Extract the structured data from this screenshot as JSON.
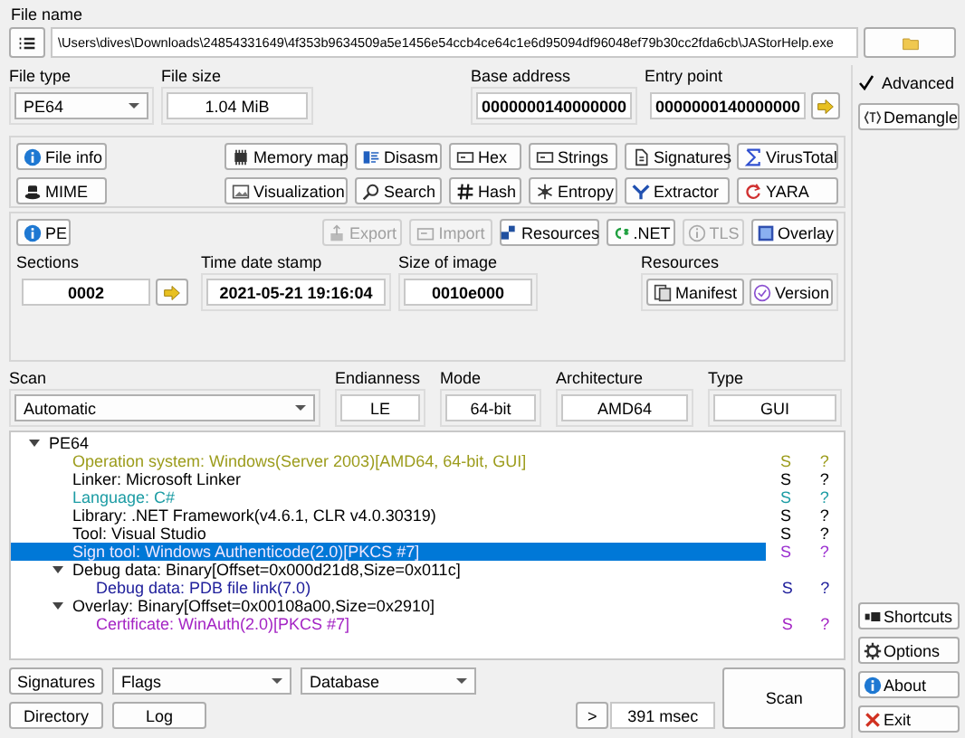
{
  "file_name": {
    "label": "File name",
    "path": "\\Users\\dives\\Downloads\\24854331649\\4f353b9634509a5e1456e54ccb4ce64c1e6d95094df96048ef79b30cc2fda6cb\\JAStorHelp.exe"
  },
  "file_type": {
    "label": "File type",
    "value": "PE64"
  },
  "file_size": {
    "label": "File size",
    "value": "1.04 MiB"
  },
  "base_address": {
    "label": "Base address",
    "value": "0000000140000000"
  },
  "entry_point": {
    "label": "Entry point",
    "value": "0000000140000000"
  },
  "tools_row_1": [
    "File info",
    "Memory map",
    "Disasm",
    "Hex",
    "Strings",
    "Signatures",
    "VirusTotal"
  ],
  "tools_row_2": [
    "MIME",
    "Visualization",
    "Search",
    "Hash",
    "Entropy",
    "Extractor",
    "YARA"
  ],
  "pe_panel": {
    "title": "PE",
    "buttons": [
      {
        "label": "Export",
        "disabled": true
      },
      {
        "label": "Import",
        "disabled": true
      },
      {
        "label": "Resources",
        "disabled": false
      },
      {
        "label": ".NET",
        "disabled": false
      },
      {
        "label": "TLS",
        "disabled": true
      },
      {
        "label": "Overlay",
        "disabled": false
      }
    ],
    "sections": {
      "label": "Sections",
      "value": "0002"
    },
    "time_date_stamp": {
      "label": "Time date stamp",
      "value": "2021-05-21 19:16:04"
    },
    "size_of_image": {
      "label": "Size of image",
      "value": "0010e000"
    },
    "resources": {
      "label": "Resources",
      "buttons": [
        "Manifest",
        "Version"
      ]
    }
  },
  "scan": {
    "label": "Scan",
    "value": "Automatic"
  },
  "endianness": {
    "label": "Endianness",
    "value": "LE"
  },
  "mode": {
    "label": "Mode",
    "value": "64-bit"
  },
  "architecture": {
    "label": "Architecture",
    "value": "AMD64"
  },
  "type": {
    "label": "Type",
    "value": "GUI"
  },
  "results": {
    "text": "PE64",
    "expanded": true,
    "selected": false,
    "children": [
      {
        "text": "Operation system: Windows(Server 2003)[AMD64, 64-bit, GUI]",
        "color": "#9c9c1c",
        "column_2": "S",
        "column_3": "?",
        "selected": false
      },
      {
        "text": "Linker: Microsoft Linker",
        "color": "#000000",
        "column_2": "S",
        "column_3": "?",
        "selected": false
      },
      {
        "text": "Language: C#",
        "color": "#1c9ca4",
        "column_2": "S",
        "column_3": "?",
        "selected": false
      },
      {
        "text": "Library: .NET Framework(v4.6.1, CLR v4.0.30319)",
        "color": "#000000",
        "column_2": "S",
        "column_3": "?",
        "selected": false
      },
      {
        "text": "Tool: Visual Studio",
        "color": "#000000",
        "column_2": "S",
        "column_3": "?",
        "selected": false
      },
      {
        "text": "Sign tool: Windows Authenticode(2.0)[PKCS #7]",
        "color": "#9b30d0",
        "column_2": "S",
        "column_3": "?",
        "selected": true
      },
      {
        "text": "Debug data: Binary[Offset=0x000d21d8,Size=0x011c]",
        "expanded": true,
        "selected": false,
        "children": [
          {
            "text": "Debug data: PDB file link(7.0)",
            "color": "#20209c",
            "column_2": "S",
            "column_3": "?",
            "selected": false
          }
        ]
      },
      {
        "text": "Overlay: Binary[Offset=0x00108a00,Size=0x2910]",
        "expanded": true,
        "selected": false,
        "children": [
          {
            "text": "Certificate: WinAuth(2.0)[PKCS #7]",
            "color": "#a424c4",
            "column_2": "S",
            "column_3": "?",
            "selected": false
          }
        ]
      }
    ]
  },
  "bottom": {
    "signatures": "Signatures",
    "flags": "Flags",
    "database": "Database",
    "directory": "Directory",
    "log": "Log",
    "more": ">",
    "time": "391 msec",
    "scan": "Scan"
  },
  "advanced": {
    "label": "Advanced",
    "checked": true
  },
  "demangle": "Demangle",
  "side_buttons": [
    "Shortcuts",
    "Options",
    "About",
    "Exit"
  ]
}
